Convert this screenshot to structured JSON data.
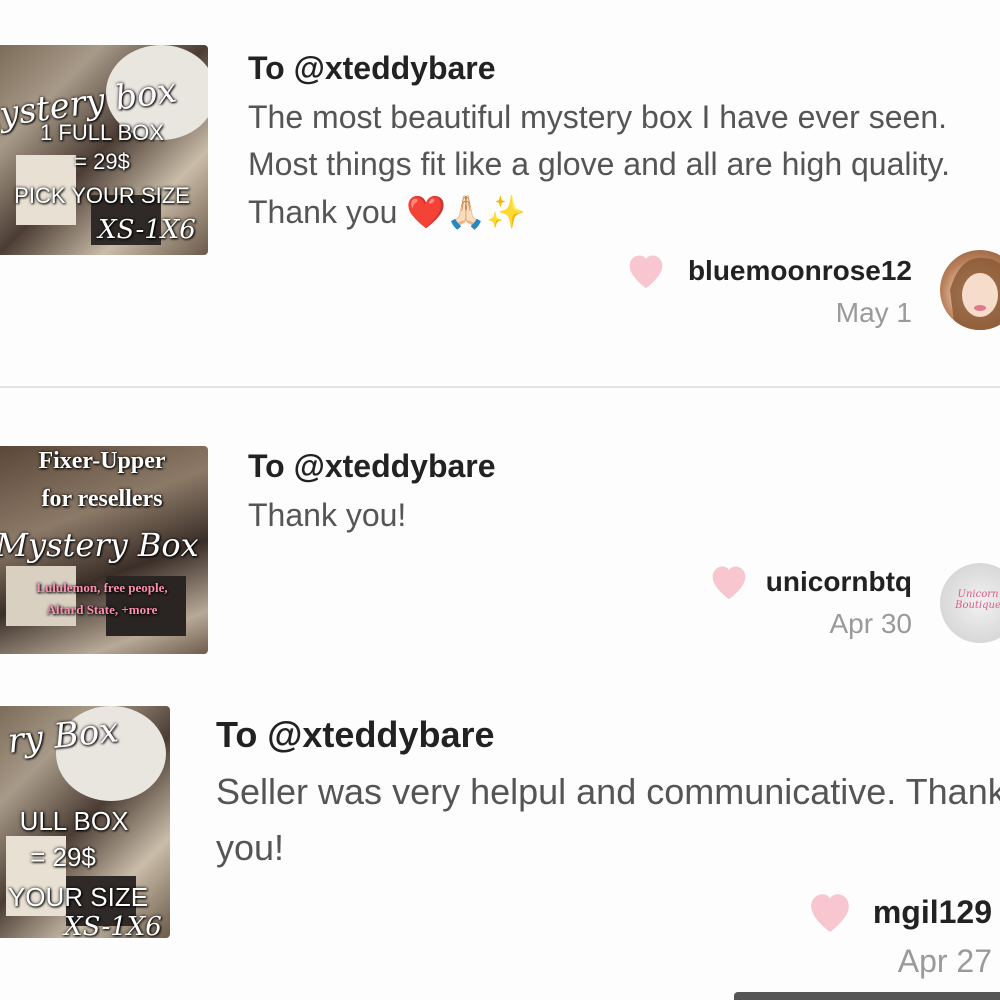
{
  "reviews": [
    {
      "thumb_lines": [
        "mystery box",
        "1 FULL BOX",
        "= 29$",
        "PICK YOUR SIZE",
        "XS-1X6"
      ],
      "to": "To @xteddybare",
      "body": "The most beautiful mystery box I have ever seen. Most things fit like a glove and all are high quality. Thank you ❤️🙏🏻✨",
      "user": "bluemoonrose12",
      "date": "May 1"
    },
    {
      "thumb_lines": [
        "Fixer-Upper",
        "for resellers",
        "Mystery Box",
        "Lululemon, free people,",
        "Altard State, +more"
      ],
      "to": "To @xteddybare",
      "body": "Thank you!",
      "user": "unicornbtq",
      "date": "Apr 30",
      "avatar_text": "Unicorn Boutique"
    },
    {
      "thumb_lines": [
        "ry Box",
        "ULL BOX",
        "= 29$",
        "YOUR SIZE",
        "XS-1X6"
      ],
      "to": "To @xteddybare",
      "body": "Seller was very helpul and communicative. Thank you!",
      "user": "mgil129",
      "date": "Apr 27"
    }
  ],
  "colors": {
    "heart": "#f7c6cf",
    "divider": "#e4e4e4",
    "text": "#222222",
    "muted": "#9a9a9a"
  },
  "icons": {
    "like": "heart-icon"
  }
}
